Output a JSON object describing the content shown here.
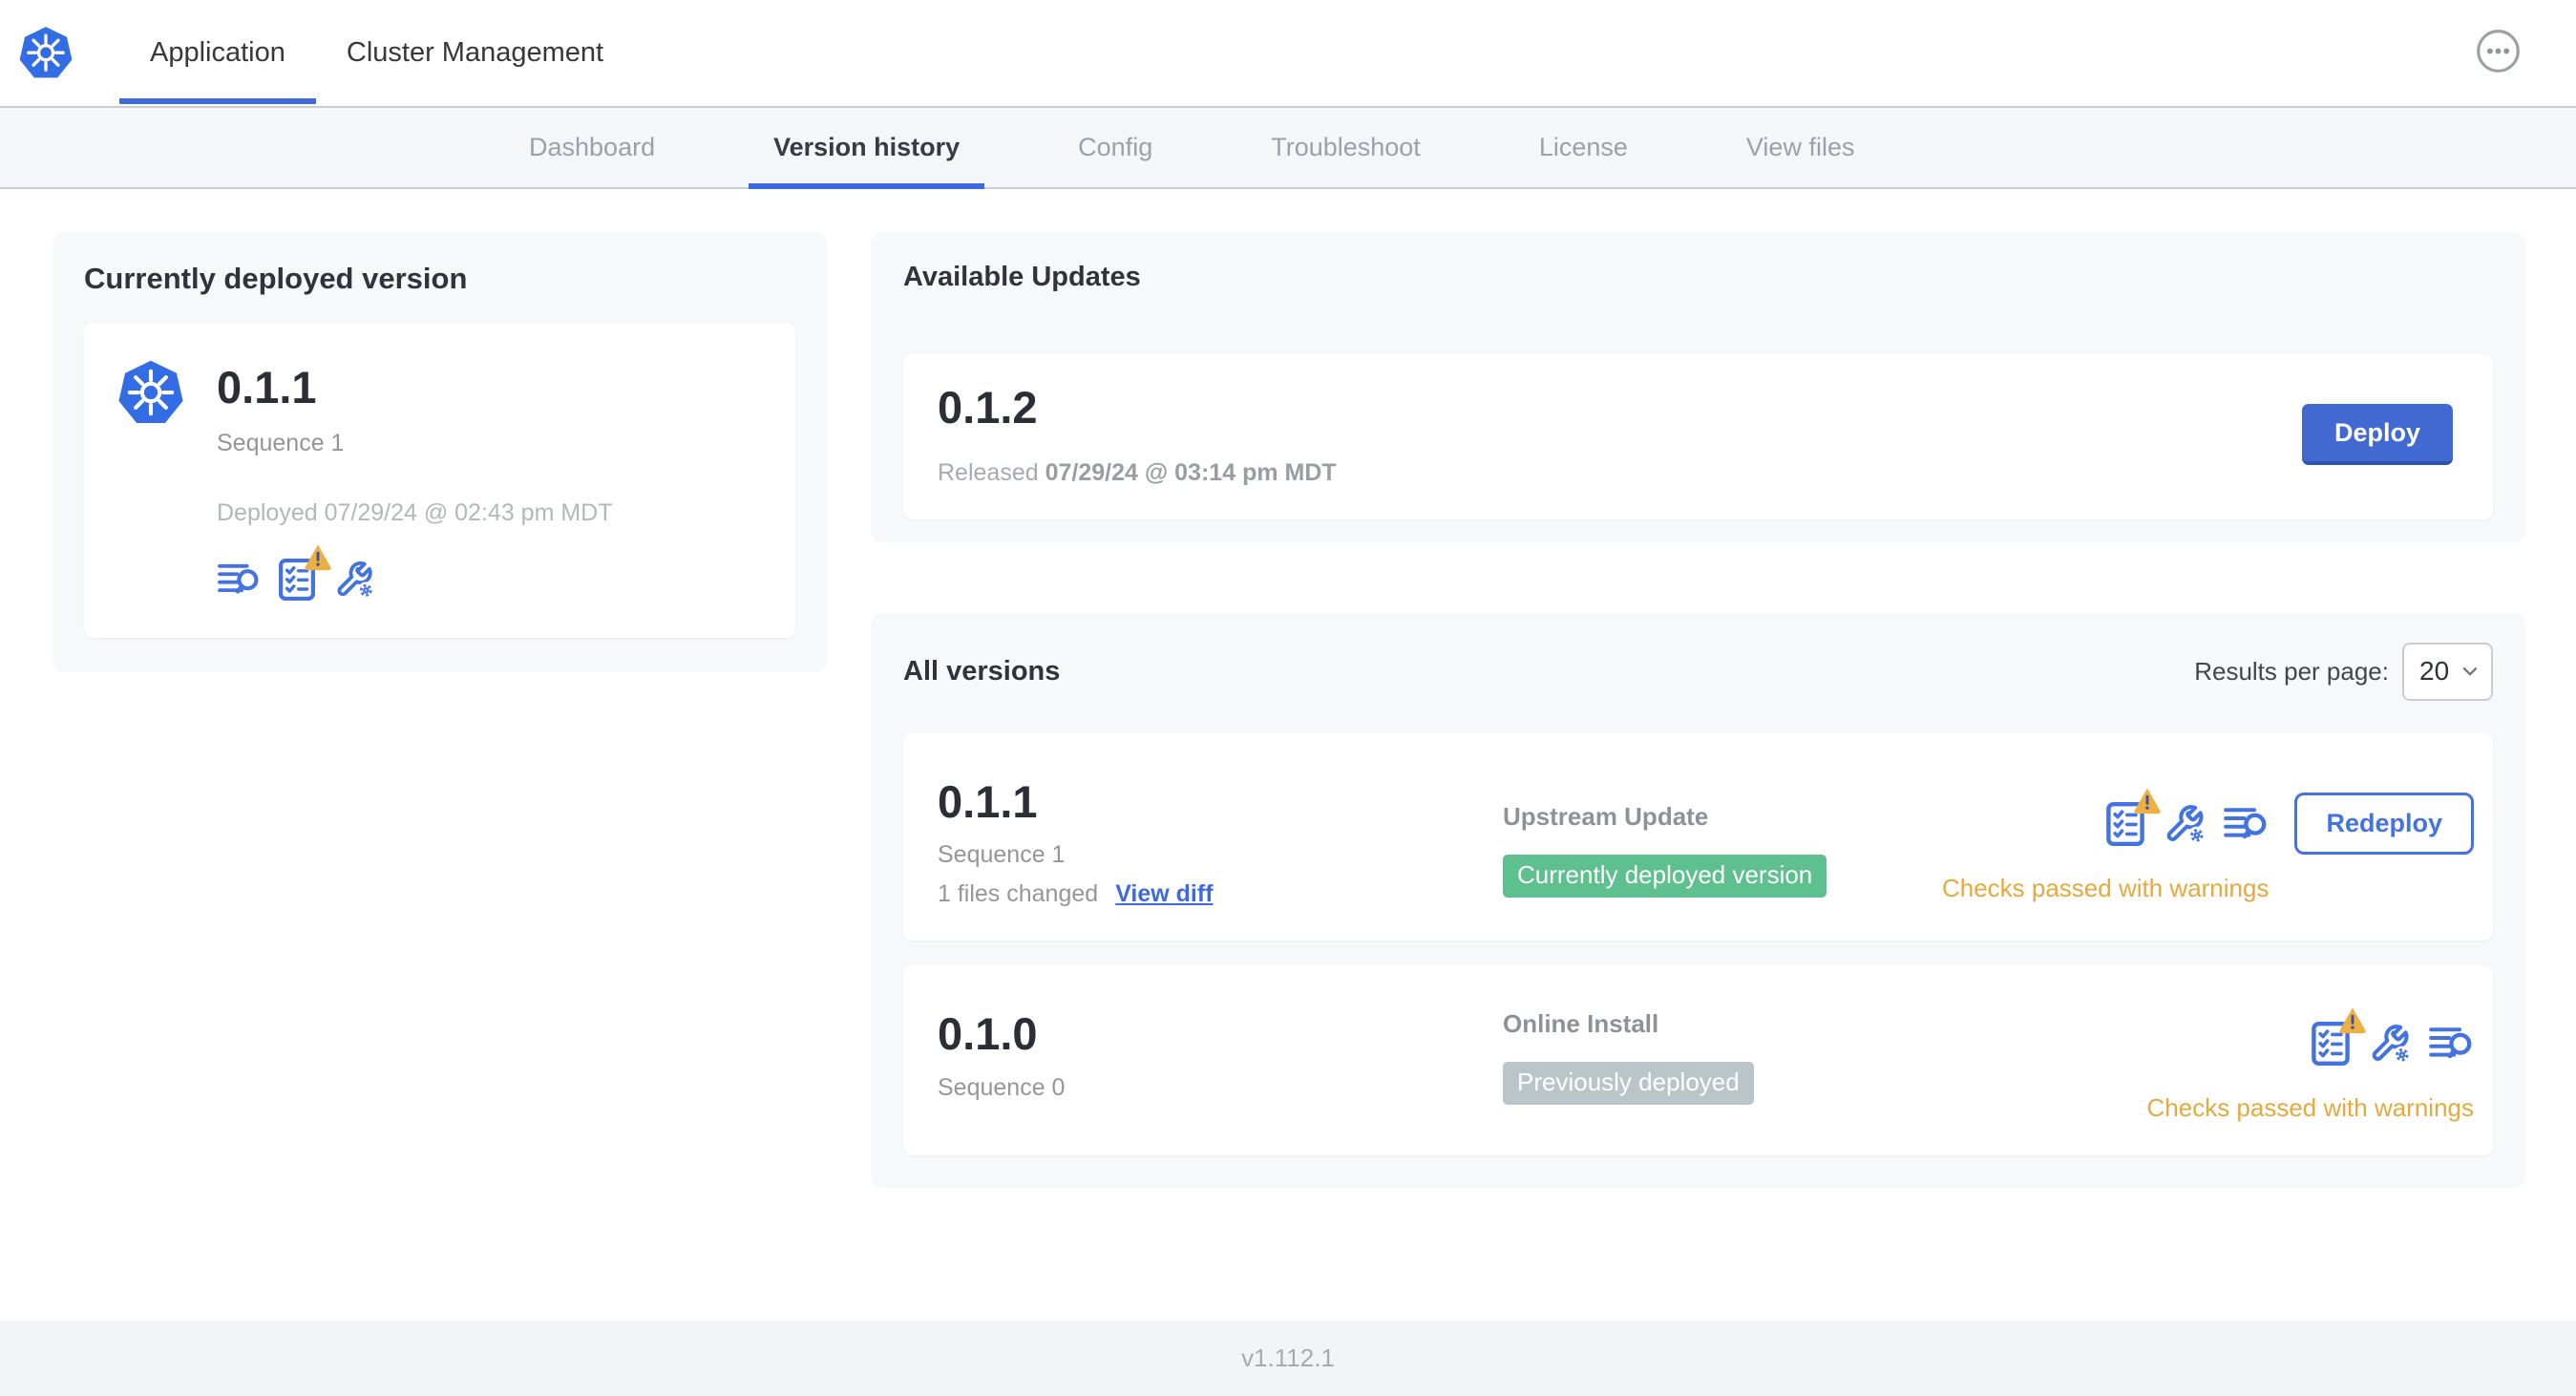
{
  "header": {
    "tabs": [
      {
        "label": "Application",
        "active": true
      },
      {
        "label": "Cluster Management",
        "active": false
      }
    ],
    "more_menu_icon": "ellipsis-circle-icon",
    "logo_icon": "kubernetes-logo-icon"
  },
  "subnav": {
    "tabs": [
      "Dashboard",
      "Version history",
      "Config",
      "Troubleshoot",
      "License",
      "View files"
    ],
    "active_tab": "Version history"
  },
  "deployed_card": {
    "title": "Currently deployed version",
    "version": "0.1.1",
    "sequence": "Sequence 1",
    "deployed_at": "Deployed 07/29/24 @ 02:43 pm MDT",
    "icons": [
      "deploy-logs-icon",
      "preflight-checks-warning-icon",
      "edit-config-icon"
    ]
  },
  "available_updates": {
    "title": "Available Updates",
    "version": "0.1.2",
    "released_prefix": "Released",
    "released_at": "07/29/24 @ 03:14 pm MDT",
    "deploy_button": "Deploy"
  },
  "all_versions": {
    "title": "All versions",
    "results_per_page_label": "Results per page:",
    "results_per_page_value": "20",
    "rows": [
      {
        "version": "0.1.1",
        "sequence": "Sequence 1",
        "files_changed": "1 files changed",
        "view_diff": "View diff",
        "source": "Upstream Update",
        "badge": "Currently deployed version",
        "badge_color": "#5fc08f",
        "status": "Checks passed with warnings",
        "action": "Redeploy",
        "icons": [
          "preflight-checks-warning-icon",
          "edit-config-icon",
          "deploy-logs-icon"
        ]
      },
      {
        "version": "0.1.0",
        "sequence": "Sequence 0",
        "source": "Online Install",
        "badge": "Previously deployed",
        "badge_color": "#bac5c9",
        "status": "Checks passed with warnings",
        "icons": [
          "preflight-checks-warning-icon",
          "edit-config-icon",
          "deploy-logs-icon"
        ]
      }
    ]
  },
  "footer": {
    "app_version": "v1.112.1"
  },
  "colors": {
    "primary_blue": "#4273e0",
    "button_blue": "#4169d2",
    "k8s_blue": "#326de6",
    "badge_green": "#5fc08f",
    "badge_gray": "#bac5c9",
    "warning_text_amber": "#e8a83b",
    "warning_triangle_amber": "#ecb042"
  }
}
